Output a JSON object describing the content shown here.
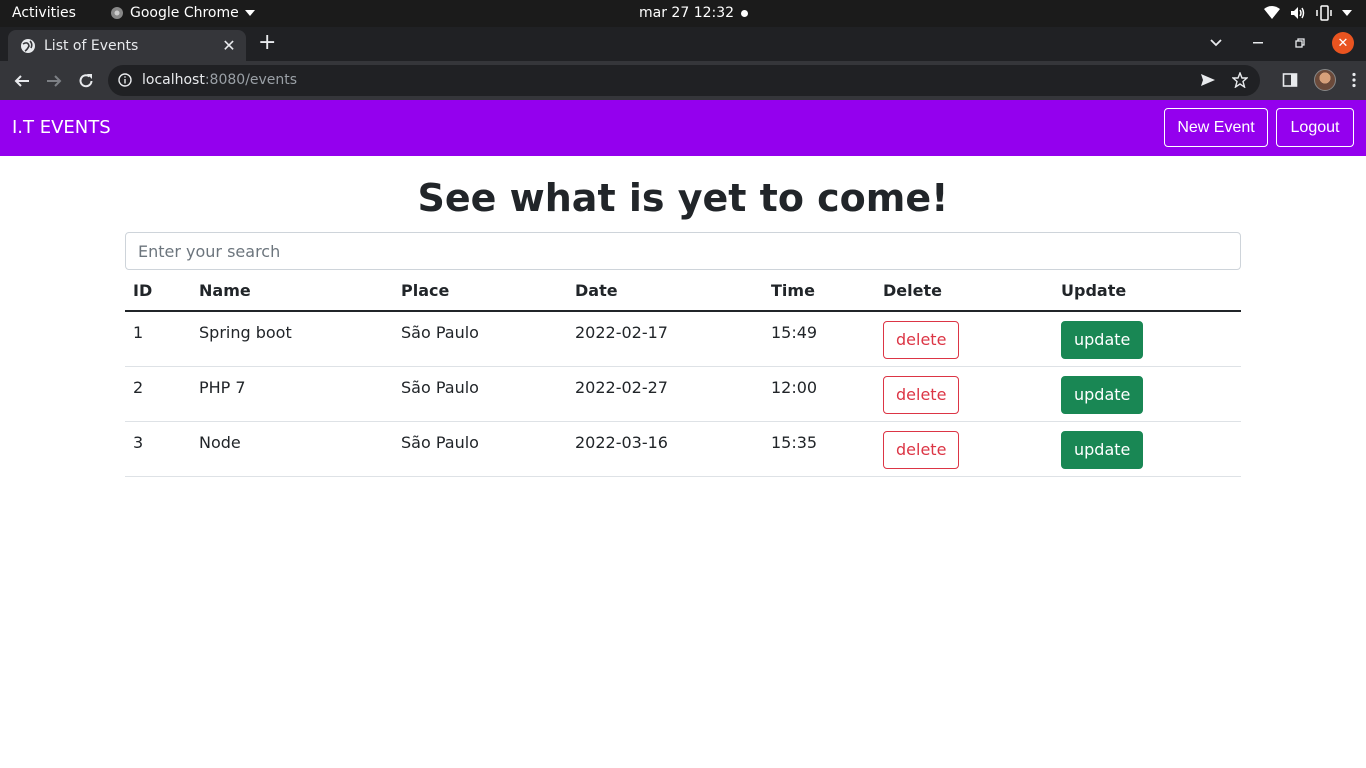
{
  "os_bar": {
    "activities": "Activities",
    "app_name": "Google Chrome",
    "clock": "mar 27  12:32"
  },
  "browser": {
    "tab_title": "List of Events",
    "url_host": "localhost",
    "url_rest": ":8080/events"
  },
  "navbar": {
    "brand": "I.T EVENTS",
    "new_event": "New Event",
    "logout": "Logout",
    "color": "#9400ee"
  },
  "main": {
    "heading": "See what is yet to come!",
    "search_placeholder": "Enter your search"
  },
  "table": {
    "headers": [
      "ID",
      "Name",
      "Place",
      "Date",
      "Time",
      "Delete",
      "Update"
    ],
    "rows": [
      {
        "id": "1",
        "name": "Spring boot",
        "place": "São Paulo",
        "date": "2022-02-17",
        "time": "15:49",
        "delete": "delete",
        "update": "update"
      },
      {
        "id": "2",
        "name": "PHP 7",
        "place": "São Paulo",
        "date": "2022-02-27",
        "time": "12:00",
        "delete": "delete",
        "update": "update"
      },
      {
        "id": "3",
        "name": "Node",
        "place": "São Paulo",
        "date": "2022-03-16",
        "time": "15:35",
        "delete": "delete",
        "update": "update"
      }
    ]
  },
  "colors": {
    "delete": "#dc3545",
    "update": "#198754"
  }
}
